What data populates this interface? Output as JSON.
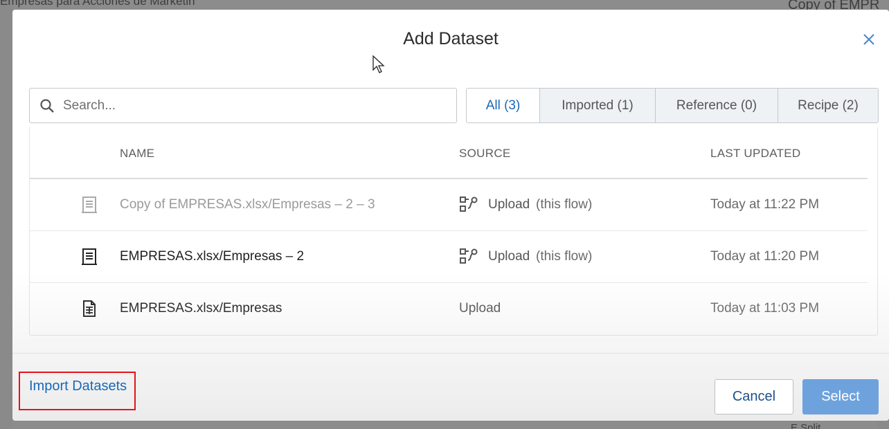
{
  "background": {
    "left_title": "Empresas para Acciones de Marketin",
    "right_title": "Copy of EMPR",
    "right_bottom": "E  Split"
  },
  "modal": {
    "title": "Add Dataset",
    "close_icon": "close-icon"
  },
  "search": {
    "placeholder": "Search...",
    "value": "",
    "icon": "search-icon"
  },
  "tabs": [
    {
      "label": "All (3)",
      "active": true
    },
    {
      "label": "Imported (1)",
      "active": false
    },
    {
      "label": "Reference (0)",
      "active": false
    },
    {
      "label": "Recipe (2)",
      "active": false
    }
  ],
  "table": {
    "columns": [
      "NAME",
      "SOURCE",
      "LAST UPDATED"
    ],
    "rows": [
      {
        "icon": "recipe-dataset-icon",
        "name": "Copy of EMPRESAS.xlsx/Empresas – 2 – 3",
        "source": "Upload",
        "source_note": "(this flow)",
        "source_icon": "flow-icon",
        "updated": "Today at 11:22 PM",
        "disabled": true
      },
      {
        "icon": "recipe-dataset-icon",
        "name": "EMPRESAS.xlsx/Empresas – 2",
        "source": "Upload",
        "source_note": "(this flow)",
        "source_icon": "flow-icon",
        "updated": "Today at 11:20 PM",
        "disabled": false
      },
      {
        "icon": "imported-dataset-icon",
        "name": "EMPRESAS.xlsx/Empresas",
        "source": "Upload",
        "source_note": "",
        "source_icon": "",
        "updated": "Today at 11:03 PM",
        "disabled": false
      }
    ]
  },
  "footer": {
    "import_link": "Import Datasets",
    "cancel": "Cancel",
    "select": "Select"
  },
  "colors": {
    "accent": "#1a68b8",
    "select_button": "#6ea2dd",
    "highlight_box": "#e8101a"
  }
}
